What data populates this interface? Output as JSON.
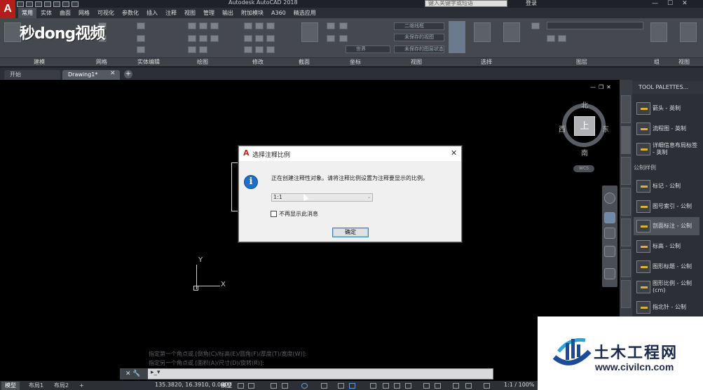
{
  "app": {
    "title": "Autodesk AutoCAD 2018",
    "logo_letter": "A",
    "search_placeholder": "键入关键字或短语",
    "signin": "登录",
    "window_controls": [
      "—",
      "☐",
      "✕"
    ]
  },
  "ribbon_tabs": [
    "常用",
    "实体",
    "曲面",
    "网格",
    "可视化",
    "参数化",
    "插入",
    "注释",
    "视图",
    "管理",
    "输出",
    "附加模块",
    "A360",
    "精选应用"
  ],
  "active_ribbon_tab": "常用",
  "ribbon_groups": [
    "建模",
    "网格",
    "实体编辑",
    "绘图",
    "修改",
    "截面",
    "坐标",
    "视图",
    "选择",
    "图层",
    "组",
    "视图"
  ],
  "ribbon_combos": [
    "二维线框",
    "未保存的视图",
    "世界",
    "未保存的图层状态"
  ],
  "watermark": "秒dong视频",
  "file_tabs": {
    "start": "开始",
    "drawing": "Drawing1*",
    "close": "✕",
    "add": "+"
  },
  "viewport_controls": [
    "—",
    "❐",
    "✕"
  ],
  "viewcube": {
    "north": "北",
    "south": "南",
    "east": "东",
    "west": "西",
    "face": "上",
    "wcs": "WCS"
  },
  "ucs": {
    "x": "X",
    "y": "Y"
  },
  "dialog": {
    "title": "选择注释比例",
    "close": "✕",
    "info_icon": "i",
    "message": "正在创建注释性对象。请将注释比例设置为注释要显示的比例。",
    "scale_value": "1:1",
    "dropdown_arrow": "⌄",
    "checkbox_label": "不再显示此消息",
    "ok_label": "确定"
  },
  "command_history": [
    "指定第一个角点或 [倒角(C)/标高(E)/圆角(F)/厚度(T)/宽度(W)]:",
    "指定另一个角点或 [面积(A)/尺寸(D)/旋转(R)]:"
  ],
  "command_line": {
    "prompt": "▸_▾",
    "left": "✕ 🔧"
  },
  "layout_tabs": [
    "模型",
    "布局1",
    "布局2",
    "+"
  ],
  "status": {
    "coords": "135.3820, 16.3910, 0.0000",
    "model": "模型",
    "scale": "1:1 / 100%"
  },
  "tool_palette": {
    "title": "TOOL PALETTES...",
    "section": "公制样例",
    "items_top": [
      "箭头 - 英制",
      "流程图 - 英制",
      "详细信息布局标签 - 英制"
    ],
    "items_bottom": [
      "标记 - 公制",
      "图号索引 - 公制",
      "剖面标注 - 公制",
      "标高 - 公制",
      "图形标题 - 公制",
      "图形比例 - 公制 (cm)",
      "指北针 - 公制"
    ],
    "selected": "剖面标注 - 公制"
  },
  "civil_watermark": {
    "cn": "土木工程网",
    "url": "www.civilcn.com"
  }
}
